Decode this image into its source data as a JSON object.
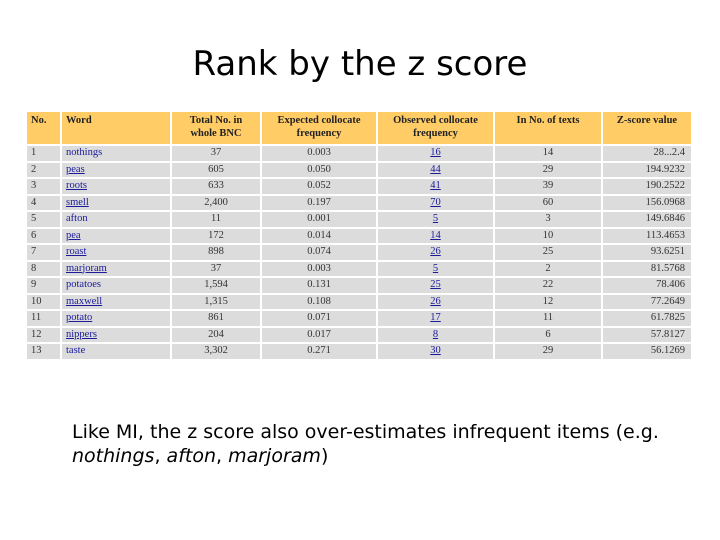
{
  "slide": {
    "title": "Rank by the z score",
    "caption": {
      "prefix": "Like MI, the z score also over-estimates infrequent items (e.g. ",
      "examples": [
        "nothings",
        "afton",
        "marjoram"
      ],
      "sep": ", ",
      "suffix": ")"
    }
  },
  "table": {
    "headers": [
      "No.",
      "Word",
      "Total No. in whole BNC",
      "Expected collocate frequency",
      "Observed collocate frequency",
      "In No. of texts",
      "Z-score value"
    ],
    "rows": [
      {
        "no": "1",
        "word": "nothings",
        "total": "37",
        "expected": "0.003",
        "observed": "16",
        "texts": "14",
        "z": "28...2.4",
        "link": false
      },
      {
        "no": "2",
        "word": "peas",
        "total": "605",
        "expected": "0.050",
        "observed": "44",
        "texts": "29",
        "z": "194.9232",
        "link": true
      },
      {
        "no": "3",
        "word": "roots",
        "total": "633",
        "expected": "0.052",
        "observed": "41",
        "texts": "39",
        "z": "190.2522",
        "link": true
      },
      {
        "no": "4",
        "word": "smell",
        "total": "2,400",
        "expected": "0.197",
        "observed": "70",
        "texts": "60",
        "z": "156.0968",
        "link": true
      },
      {
        "no": "5",
        "word": "afton",
        "total": "11",
        "expected": "0.001",
        "observed": "5",
        "texts": "3",
        "z": "149.6846",
        "link": false
      },
      {
        "no": "6",
        "word": "pea",
        "total": "172",
        "expected": "0.014",
        "observed": "14",
        "texts": "10",
        "z": "113.4653",
        "link": true
      },
      {
        "no": "7",
        "word": "roast",
        "total": "898",
        "expected": "0.074",
        "observed": "26",
        "texts": "25",
        "z": "93.6251",
        "link": true
      },
      {
        "no": "8",
        "word": "marjoram",
        "total": "37",
        "expected": "0.003",
        "observed": "5",
        "texts": "2",
        "z": "81.5768",
        "link": true
      },
      {
        "no": "9",
        "word": "potatoes",
        "total": "1,594",
        "expected": "0.131",
        "observed": "25",
        "texts": "22",
        "z": "78.406",
        "link": false
      },
      {
        "no": "10",
        "word": "maxwell",
        "total": "1,315",
        "expected": "0.108",
        "observed": "26",
        "texts": "12",
        "z": "77.2649",
        "link": true
      },
      {
        "no": "11",
        "word": "potato",
        "total": "861",
        "expected": "0.071",
        "observed": "17",
        "texts": "11",
        "z": "61.7825",
        "link": true
      },
      {
        "no": "12",
        "word": "nippers",
        "total": "204",
        "expected": "0.017",
        "observed": "8",
        "texts": "6",
        "z": "57.8127",
        "link": true
      },
      {
        "no": "13",
        "word": "taste",
        "total": "3,302",
        "expected": "0.271",
        "observed": "30",
        "texts": "29",
        "z": "56.1269",
        "link": false
      }
    ]
  },
  "colors": {
    "header_bg": "#ffcc66",
    "row_bg": "#dcdcdc",
    "link": "#1a1a9a"
  }
}
